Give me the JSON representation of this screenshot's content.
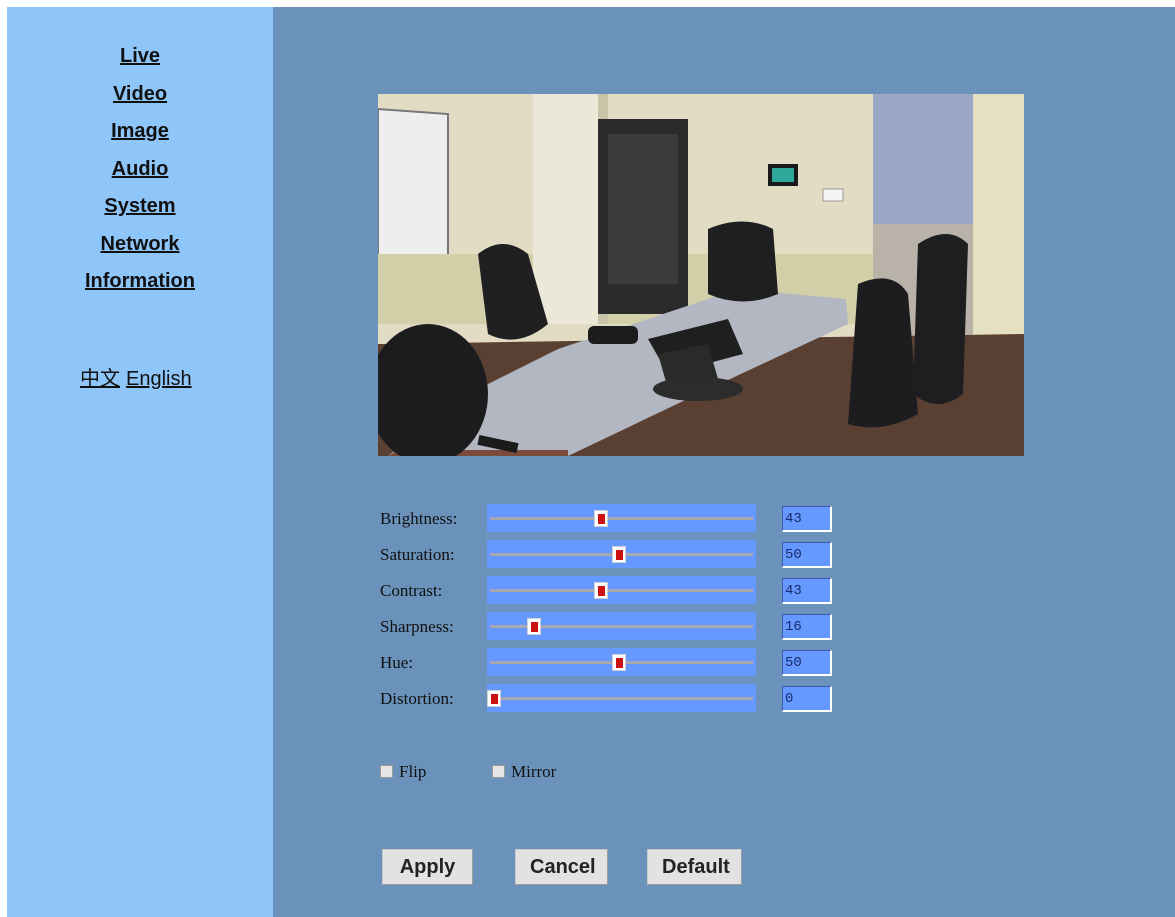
{
  "sidebar": {
    "items": [
      {
        "label": "Live"
      },
      {
        "label": "Video"
      },
      {
        "label": "Image"
      },
      {
        "label": "Audio"
      },
      {
        "label": "System"
      },
      {
        "label": "Network"
      },
      {
        "label": "Information"
      }
    ],
    "languages": [
      "中文",
      "English"
    ]
  },
  "image_settings": {
    "sliders": [
      {
        "label": "Brightness:",
        "value": "43"
      },
      {
        "label": "Saturation:",
        "value": "50"
      },
      {
        "label": "Contrast:",
        "value": "43"
      },
      {
        "label": "Sharpness:",
        "value": "16"
      },
      {
        "label": "Hue:",
        "value": "50"
      },
      {
        "label": "Distortion:",
        "value": "0"
      }
    ],
    "slider_max": 100,
    "checkboxes": [
      {
        "label": "Flip",
        "checked": false
      },
      {
        "label": "Mirror",
        "checked": false
      }
    ]
  },
  "buttons": {
    "apply": "Apply",
    "cancel": "Cancel",
    "default": "Default"
  },
  "colors": {
    "sidebar_bg": "#8fc6fa",
    "main_bg": "#6a92bb",
    "slider_track": "#6699ff",
    "slider_thumb": "#cc1111"
  }
}
